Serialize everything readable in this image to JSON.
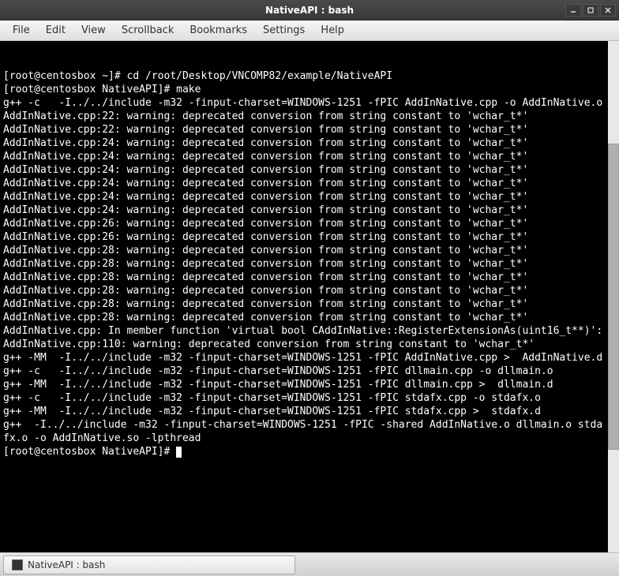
{
  "window": {
    "title": "NativeAPI : bash"
  },
  "menubar": {
    "items": [
      "File",
      "Edit",
      "View",
      "Scrollback",
      "Bookmarks",
      "Settings",
      "Help"
    ]
  },
  "terminal": {
    "lines": [
      "[root@centosbox ~]# cd /root/Desktop/VNCOMP82/example/NativeAPI",
      "[root@centosbox NativeAPI]# make",
      "g++ -c   -I../../include -m32 -finput-charset=WINDOWS-1251 -fPIC AddInNative.cpp -o AddInNative.o",
      "AddInNative.cpp:22: warning: deprecated conversion from string constant to 'wchar_t*'",
      "AddInNative.cpp:22: warning: deprecated conversion from string constant to 'wchar_t*'",
      "AddInNative.cpp:24: warning: deprecated conversion from string constant to 'wchar_t*'",
      "AddInNative.cpp:24: warning: deprecated conversion from string constant to 'wchar_t*'",
      "AddInNative.cpp:24: warning: deprecated conversion from string constant to 'wchar_t*'",
      "AddInNative.cpp:24: warning: deprecated conversion from string constant to 'wchar_t*'",
      "AddInNative.cpp:24: warning: deprecated conversion from string constant to 'wchar_t*'",
      "AddInNative.cpp:24: warning: deprecated conversion from string constant to 'wchar_t*'",
      "AddInNative.cpp:26: warning: deprecated conversion from string constant to 'wchar_t*'",
      "AddInNative.cpp:26: warning: deprecated conversion from string constant to 'wchar_t*'",
      "AddInNative.cpp:28: warning: deprecated conversion from string constant to 'wchar_t*'",
      "AddInNative.cpp:28: warning: deprecated conversion from string constant to 'wchar_t*'",
      "AddInNative.cpp:28: warning: deprecated conversion from string constant to 'wchar_t*'",
      "AddInNative.cpp:28: warning: deprecated conversion from string constant to 'wchar_t*'",
      "AddInNative.cpp:28: warning: deprecated conversion from string constant to 'wchar_t*'",
      "AddInNative.cpp:28: warning: deprecated conversion from string constant to 'wchar_t*'",
      "AddInNative.cpp: In member function 'virtual bool CAddInNative::RegisterExtensionAs(uint16_t**)':",
      "AddInNative.cpp:110: warning: deprecated conversion from string constant to 'wchar_t*'",
      "g++ -MM  -I../../include -m32 -finput-charset=WINDOWS-1251 -fPIC AddInNative.cpp >  AddInNative.d",
      "g++ -c   -I../../include -m32 -finput-charset=WINDOWS-1251 -fPIC dllmain.cpp -o dllmain.o",
      "g++ -MM  -I../../include -m32 -finput-charset=WINDOWS-1251 -fPIC dllmain.cpp >  dllmain.d",
      "g++ -c   -I../../include -m32 -finput-charset=WINDOWS-1251 -fPIC stdafx.cpp -o stdafx.o",
      "g++ -MM  -I../../include -m32 -finput-charset=WINDOWS-1251 -fPIC stdafx.cpp >  stdafx.d",
      "g++  -I../../include -m32 -finput-charset=WINDOWS-1251 -fPIC -shared AddInNative.o dllmain.o stdafx.o -o AddInNative.so -lpthread",
      "[root@centosbox NativeAPI]# "
    ]
  },
  "taskbar": {
    "item_label": "NativeAPI : bash"
  }
}
